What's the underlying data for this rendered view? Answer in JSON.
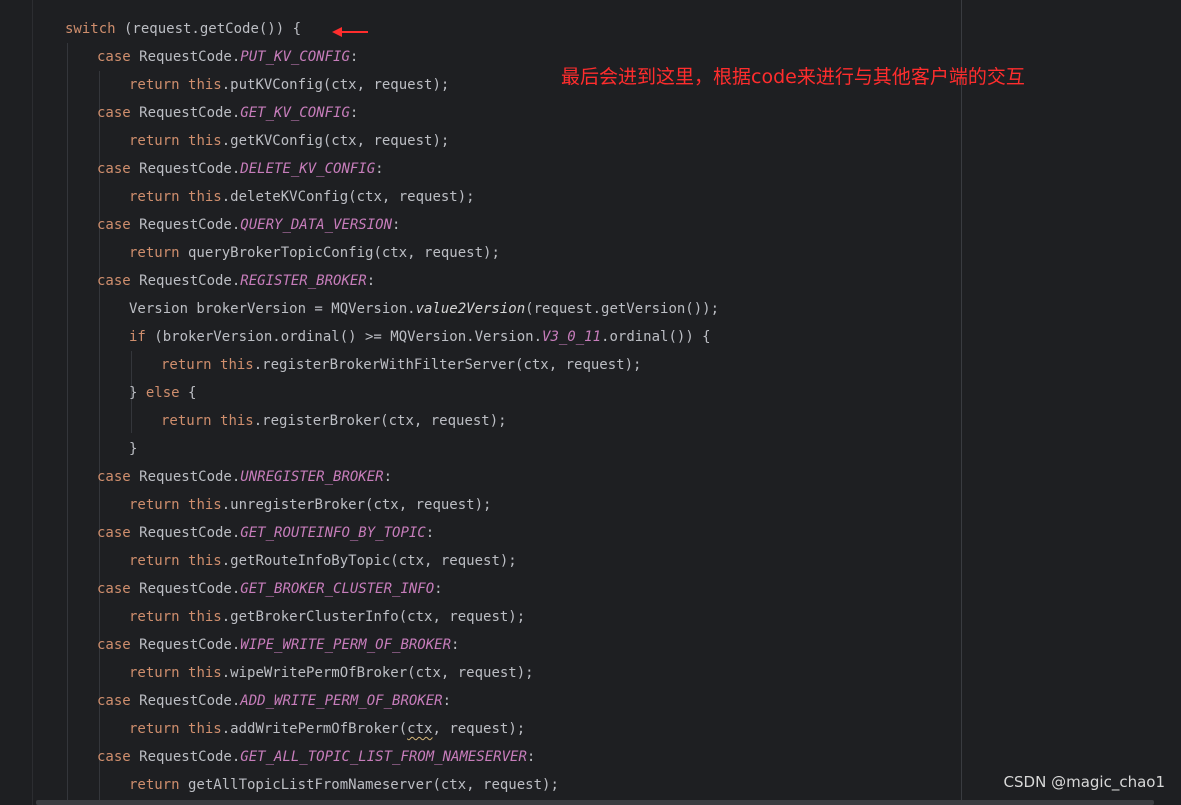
{
  "code": {
    "l1": {
      "kw": "switch",
      "rest": " (request.getCode()) {"
    },
    "l2": {
      "kw": "case",
      "cls": " RequestCode.",
      "const": "PUT_KV_CONFIG",
      "end": ":"
    },
    "l3": {
      "kw1": "return",
      "kw2": "this",
      "rest": ".putKVConfig(ctx, request);"
    },
    "l4": {
      "kw": "case",
      "cls": " RequestCode.",
      "const": "GET_KV_CONFIG",
      "end": ":"
    },
    "l5": {
      "kw1": "return",
      "kw2": "this",
      "rest": ".getKVConfig(ctx, request);"
    },
    "l6": {
      "kw": "case",
      "cls": " RequestCode.",
      "const": "DELETE_KV_CONFIG",
      "end": ":"
    },
    "l7": {
      "kw1": "return",
      "kw2": "this",
      "rest": ".deleteKVConfig(ctx, request);"
    },
    "l8": {
      "kw": "case",
      "cls": " RequestCode.",
      "const": "QUERY_DATA_VERSION",
      "end": ":"
    },
    "l9": {
      "kw1": "return",
      "rest": " queryBrokerTopicConfig(ctx, request);"
    },
    "l10": {
      "kw": "case",
      "cls": " RequestCode.",
      "const": "REGISTER_BROKER",
      "end": ":"
    },
    "l11": {
      "a": "Version brokerVersion = MQVersion.",
      "ital": "value2Version",
      "b": "(request.getVersion());"
    },
    "l12": {
      "kw": "if",
      "a": " (brokerVersion.ordinal() >= MQVersion.Version.",
      "const": "V3_0_11",
      "b": ".ordinal()) {"
    },
    "l13": {
      "kw1": "return",
      "kw2": "this",
      "rest": ".registerBrokerWithFilterServer(ctx, request);"
    },
    "l14": {
      "a": "} ",
      "kw": "else",
      "b": " {"
    },
    "l15": {
      "kw1": "return",
      "kw2": "this",
      "rest": ".registerBroker(ctx, request);"
    },
    "l16": {
      "a": "}"
    },
    "l17": {
      "kw": "case",
      "cls": " RequestCode.",
      "const": "UNREGISTER_BROKER",
      "end": ":"
    },
    "l18": {
      "kw1": "return",
      "kw2": "this",
      "rest": ".unregisterBroker(ctx, request);"
    },
    "l19": {
      "kw": "case",
      "cls": " RequestCode.",
      "const": "GET_ROUTEINFO_BY_TOPIC",
      "end": ":"
    },
    "l20": {
      "kw1": "return",
      "kw2": "this",
      "rest": ".getRouteInfoByTopic(ctx, request);"
    },
    "l21": {
      "kw": "case",
      "cls": " RequestCode.",
      "const": "GET_BROKER_CLUSTER_INFO",
      "end": ":"
    },
    "l22": {
      "kw1": "return",
      "kw2": "this",
      "rest": ".getBrokerClusterInfo(ctx, request);"
    },
    "l23": {
      "kw": "case",
      "cls": " RequestCode.",
      "const": "WIPE_WRITE_PERM_OF_BROKER",
      "end": ":"
    },
    "l24": {
      "kw1": "return",
      "kw2": "this",
      "rest": ".wipeWritePermOfBroker(ctx, request);"
    },
    "l25": {
      "kw": "case",
      "cls": " RequestCode.",
      "const": "ADD_WRITE_PERM_OF_BROKER",
      "end": ":"
    },
    "l26": {
      "kw1": "return",
      "kw2": "this",
      "a": ".addWritePermOfBroker(",
      "squig": "ctx",
      "b": ", request);"
    },
    "l27": {
      "kw": "case",
      "cls": " RequestCode.",
      "const": "GET_ALL_TOPIC_LIST_FROM_NAMESERVER",
      "end": ":"
    },
    "l28": {
      "kw1": "return",
      "rest": " getAllTopicListFromNameserver(ctx, request);"
    }
  },
  "annotation": {
    "text": "最后会进到这里，根据code来进行与其他客户端的交互",
    "color": "#ff2d2d"
  },
  "watermark": "CSDN @magic_chao1",
  "colors": {
    "background": "#1e1f22",
    "keyword": "#cf8e6d",
    "constant": "#c77dbb",
    "text": "#bcbec4"
  }
}
